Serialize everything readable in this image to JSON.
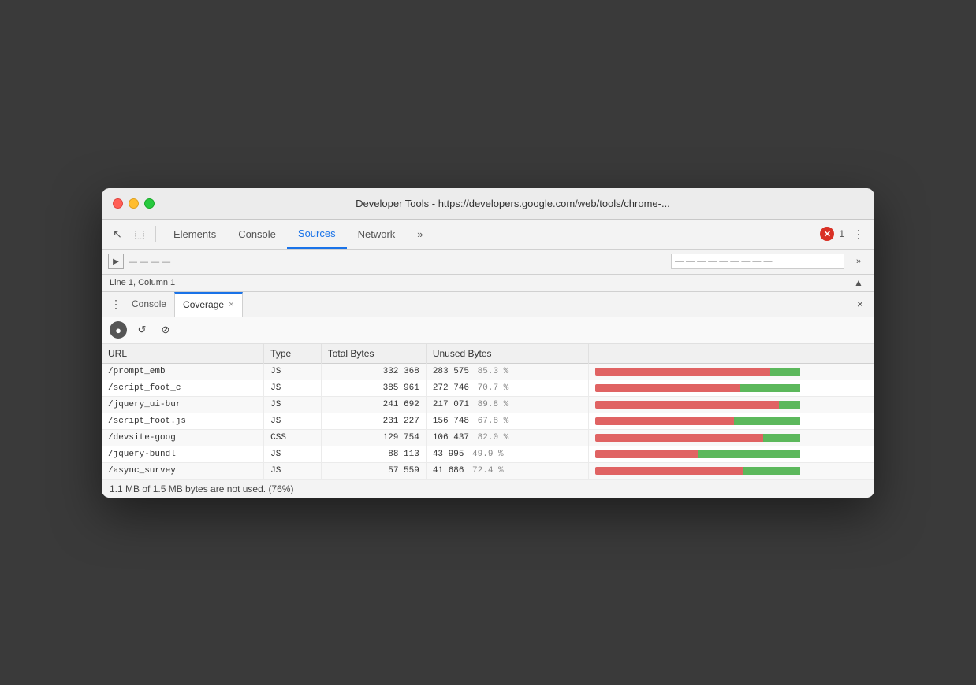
{
  "window": {
    "title": "Developer Tools - https://developers.google.com/web/tools/chrome-..."
  },
  "devtools": {
    "tabs": [
      {
        "label": "Elements",
        "active": false
      },
      {
        "label": "Console",
        "active": false
      },
      {
        "label": "Sources",
        "active": true
      },
      {
        "label": "Network",
        "active": false
      },
      {
        "label": "»",
        "active": false
      }
    ],
    "error_count": "1",
    "status": "Line 1, Column 1",
    "panel_tabs": [
      {
        "label": "Console",
        "active": false,
        "closable": false
      },
      {
        "label": "Coverage",
        "active": true,
        "closable": true
      }
    ]
  },
  "coverage": {
    "columns": [
      "URL",
      "Type",
      "Total Bytes",
      "Unused Bytes",
      ""
    ],
    "rows": [
      {
        "url": "/prompt_emb",
        "type": "JS",
        "total": "332 368",
        "unused": "283 575",
        "pct": "85.3 %",
        "red_pct": 85.3,
        "green_pct": 14.7
      },
      {
        "url": "/script_foot_c",
        "type": "JS",
        "total": "385 961",
        "unused": "272 746",
        "pct": "70.7 %",
        "red_pct": 70.7,
        "green_pct": 29.3
      },
      {
        "url": "/jquery_ui-bur",
        "type": "JS",
        "total": "241 692",
        "unused": "217 071",
        "pct": "89.8 %",
        "red_pct": 89.8,
        "green_pct": 10.2
      },
      {
        "url": "/script_foot.js",
        "type": "JS",
        "total": "231 227",
        "unused": "156 748",
        "pct": "67.8 %",
        "red_pct": 67.8,
        "green_pct": 32.2
      },
      {
        "url": "/devsite-goog",
        "type": "CSS",
        "total": "129 754",
        "unused": "106 437",
        "pct": "82.0 %",
        "red_pct": 82.0,
        "green_pct": 18.0
      },
      {
        "url": "/jquery-bundl",
        "type": "JS",
        "total": "88 113",
        "unused": "43 995",
        "pct": "49.9 %",
        "red_pct": 49.9,
        "green_pct": 50.1
      },
      {
        "url": "/async_survey",
        "type": "JS",
        "total": "57 559",
        "unused": "41 686",
        "pct": "72.4 %",
        "red_pct": 72.4,
        "green_pct": 27.6
      }
    ],
    "footer": "1.1 MB of 1.5 MB bytes are not used. (76%)"
  },
  "icons": {
    "cursor": "↖",
    "inspect": "⬚",
    "more_vert": "⋮",
    "chevron_right": "▶",
    "collapse": "▲",
    "refresh": "↺",
    "stop": "⊘",
    "record": "●",
    "close": "×"
  }
}
